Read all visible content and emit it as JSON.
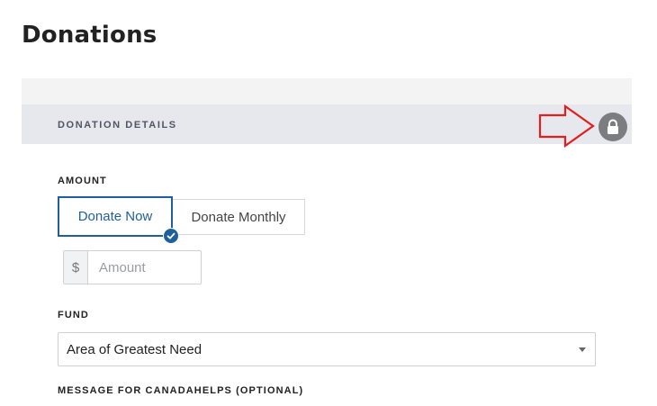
{
  "page": {
    "title": "Donations"
  },
  "section": {
    "title": "DONATION DETAILS",
    "lock_icon": "lock-icon",
    "arrow_color": "#e02020"
  },
  "amount": {
    "label": "AMOUNT",
    "tabs": [
      {
        "label": "Donate Now",
        "selected": true
      },
      {
        "label": "Donate Monthly",
        "selected": false
      }
    ],
    "currency": "$",
    "placeholder": "Amount",
    "value": ""
  },
  "fund": {
    "label": "FUND",
    "selected": "Area of Greatest Need"
  },
  "message": {
    "label": "MESSAGE FOR CANADAHELPS (OPTIONAL)"
  },
  "colors": {
    "accent": "#1f5f9e",
    "header_bg": "#e7e8ed"
  }
}
